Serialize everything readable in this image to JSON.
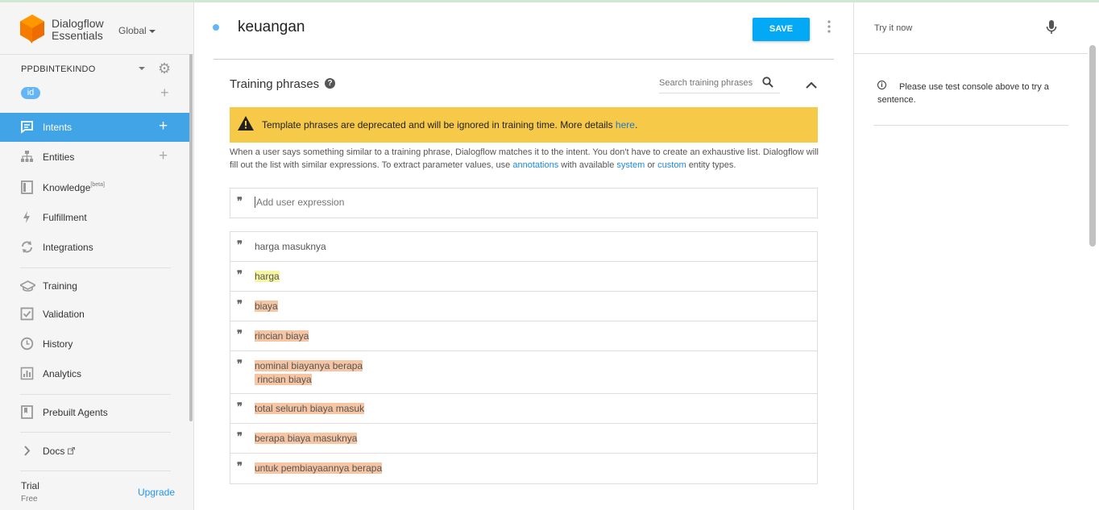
{
  "app": {
    "name_line1": "Dialogflow",
    "name_line2": "Essentials",
    "region": "Global"
  },
  "agent": {
    "name": "PPDBINTEKINDO",
    "language": "id"
  },
  "sidebar": {
    "items": [
      {
        "label": "Intents",
        "icon": "chat-icon",
        "active": true
      },
      {
        "label": "Entities",
        "icon": "hierarchy-icon"
      },
      {
        "label": "Knowledge",
        "icon": "book-icon",
        "badge": "[beta]"
      },
      {
        "label": "Fulfillment",
        "icon": "bolt-icon"
      },
      {
        "label": "Integrations",
        "icon": "sync-icon"
      },
      {
        "label": "Training",
        "icon": "graduation-cap-icon"
      },
      {
        "label": "Validation",
        "icon": "checkbox-icon"
      },
      {
        "label": "History",
        "icon": "clock-icon"
      },
      {
        "label": "Analytics",
        "icon": "bar-chart-icon"
      },
      {
        "label": "Prebuilt Agents",
        "icon": "book-bookmark-icon"
      },
      {
        "label": "Docs",
        "icon": "chevron-right-icon"
      }
    ],
    "plan": "Trial",
    "plan_sub": "Free",
    "upgrade": "Upgrade"
  },
  "intent": {
    "name": "keuangan",
    "save_label": "SAVE"
  },
  "training": {
    "title": "Training phrases",
    "search_placeholder": "Search training phrases",
    "warning_text": "Template phrases are deprecated and will be ignored in training time. More details",
    "warning_link": "here",
    "desc_part1": "When a user says something similar to a training phrase, Dialogflow matches it to the intent. You don't have to create an exhaustive list. Dialogflow will fill out the list with similar expressions. To extract parameter values, use",
    "desc_link1": "annotations",
    "desc_part2": "with available",
    "desc_link2": "system",
    "desc_part3": "or",
    "desc_link3": "custom",
    "desc_part4": "entity types.",
    "add_placeholder": "Add user expression",
    "phrases": [
      {
        "line1": "harga masuknya",
        "line2": null,
        "highlight": "none"
      },
      {
        "line1": "harga",
        "line2": null,
        "highlight": "yellow"
      },
      {
        "line1": "biaya",
        "line2": null,
        "highlight": "orange"
      },
      {
        "line1": "rincian biaya",
        "line2": null,
        "highlight": "orange"
      },
      {
        "line1": "nominal biayanya berapa",
        "line2": " rincian biaya",
        "highlight": "orange"
      },
      {
        "line1": "total seluruh biaya masuk",
        "line2": null,
        "highlight": "orange"
      },
      {
        "line1": "berapa biaya masuknya",
        "line2": null,
        "highlight": "orange"
      },
      {
        "line1": "untuk pembiayaannya berapa",
        "line2": null,
        "highlight": "orange"
      }
    ]
  },
  "console": {
    "try_label": "Try it now",
    "info": "Please use test console above to try a sentence."
  },
  "colors": {
    "accent": "#40a4e6",
    "save": "#03a9f4",
    "warning_bg": "#f7c948",
    "highlight_yellow": "#f7f6a0",
    "highlight_orange": "#f6c6a4",
    "logo": "#ff8a00"
  }
}
